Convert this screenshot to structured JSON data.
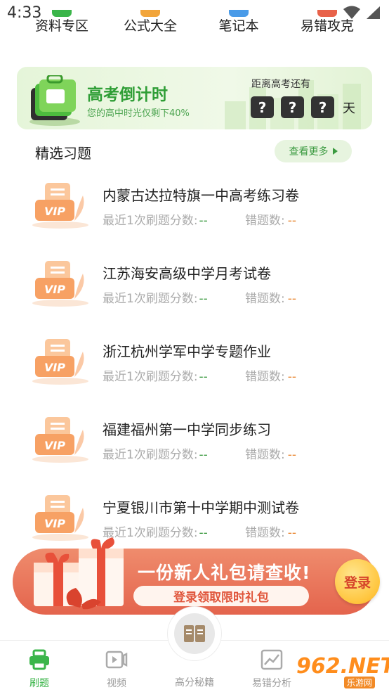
{
  "status": {
    "time": "4:33"
  },
  "top_nav": {
    "items": [
      "资料专区",
      "公式大全",
      "笔记本",
      "易错攻克"
    ]
  },
  "countdown": {
    "title": "高考倒计时",
    "subtitle": "您的高中时光仅剩下40%",
    "until_label": "距离高考还有",
    "digits": [
      "?",
      "?",
      "?"
    ],
    "unit": "天"
  },
  "section": {
    "title": "精选习题",
    "more_label": "查看更多"
  },
  "exercises": [
    {
      "name": "内蒙古达拉特旗一中高考练习卷",
      "score_label": "最近1次刷题分数:",
      "score_value": "--",
      "errors_label": "错题数:",
      "errors_value": "--",
      "badge": "VIP"
    },
    {
      "name": "江苏海安高级中学月考试卷",
      "score_label": "最近1次刷题分数:",
      "score_value": "--",
      "errors_label": "错题数:",
      "errors_value": "--",
      "badge": "VIP"
    },
    {
      "name": "浙江杭州学军中学专题作业",
      "score_label": "最近1次刷题分数:",
      "score_value": "--",
      "errors_label": "错题数:",
      "errors_value": "--",
      "badge": "VIP"
    },
    {
      "name": "福建福州第一中学同步练习",
      "score_label": "最近1次刷题分数:",
      "score_value": "--",
      "errors_label": "错题数:",
      "errors_value": "--",
      "badge": "VIP"
    },
    {
      "name": "宁夏银川市第十中学期中测试卷",
      "score_label": "最近1次刷题分数:",
      "score_value": "--",
      "errors_label": "错题数:",
      "errors_value": "--",
      "badge": "VIP"
    }
  ],
  "promo": {
    "headline": "一份新人礼包请查收!",
    "cta_pill": "登录领取限时礼包",
    "login_label": "登录"
  },
  "tabs": [
    {
      "label": "刷题",
      "icon": "printer-icon",
      "active": true
    },
    {
      "label": "视频",
      "icon": "video-icon",
      "active": false
    },
    {
      "label": "高分秘籍",
      "icon": "book-icon",
      "active": false
    },
    {
      "label": "易错分析",
      "icon": "chart-icon",
      "active": false
    }
  ],
  "watermark": {
    "main": "962.NET",
    "sub": "乐游网"
  },
  "colors": {
    "accent": "#3bb54a",
    "promo": "#e4644d",
    "error_value": "#e9852f"
  }
}
